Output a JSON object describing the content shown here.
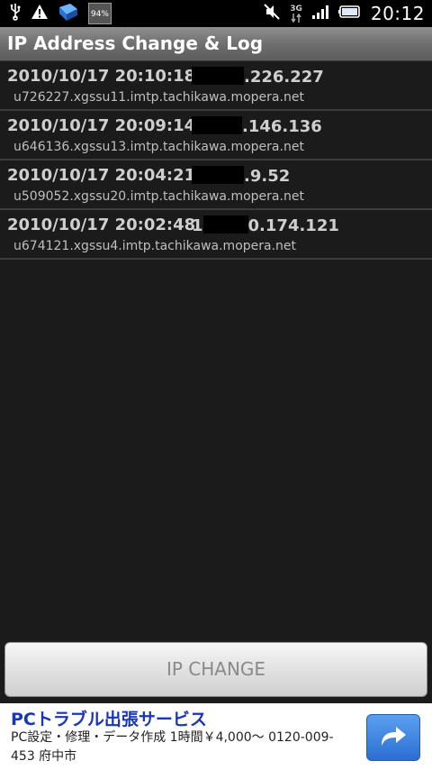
{
  "status_bar": {
    "icons_left": [
      "usb-icon",
      "warning-icon",
      "app-icon",
      "battery-percent-icon"
    ],
    "battery_percent": "94%",
    "icons_right": [
      "mute-icon",
      "3g-icon",
      "signal-icon",
      "battery-icon"
    ],
    "network": "3G",
    "time": "20:12"
  },
  "app": {
    "title": "IP Address Change & Log"
  },
  "log": [
    {
      "stamp": "2010/10/17 20:10:18",
      "ip_prefix": "",
      "ip_suffix": ".226.227",
      "host": "u726227.xgssu11.imtp.tachikawa.mopera.net"
    },
    {
      "stamp": "2010/10/17 20:09:14",
      "ip_prefix": "",
      "ip_suffix": ".146.136",
      "host": "u646136.xgssu13.imtp.tachikawa.mopera.net"
    },
    {
      "stamp": "2010/10/17 20:04:21",
      "ip_prefix": "",
      "ip_suffix": ".9.52",
      "host": "u509052.xgssu20.imtp.tachikawa.mopera.net"
    },
    {
      "stamp": "2010/10/17 20:02:48",
      "ip_prefix": "1",
      "ip_suffix": "0.174.121",
      "host": "u674121.xgssu4.imtp.tachikawa.mopera.net"
    }
  ],
  "button": {
    "label": "IP CHANGE"
  },
  "ad": {
    "title": "PCトラブル出張サービス",
    "body": "PC設定・修理・データ作成 1時間￥4,000～ 0120-009-453 府中市",
    "arrow_icon": "share-arrow-icon"
  },
  "colors": {
    "background": "#1b1b1b",
    "ad_title": "#1836b8",
    "ad_button": "#2c6fd2"
  }
}
